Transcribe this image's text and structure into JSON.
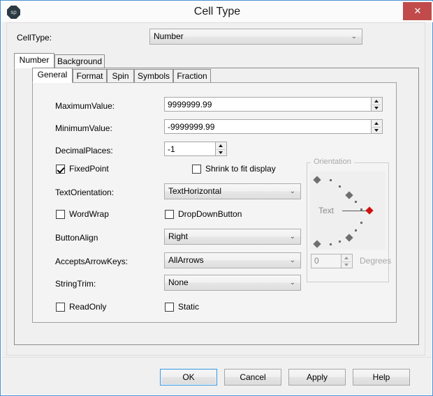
{
  "window": {
    "title": "Cell Type",
    "app_icon_text": "sp",
    "close_label": "✕",
    "accent_border": "#4a8fd0",
    "close_bg": "#c14b4b"
  },
  "celltype": {
    "label": "CellType:",
    "value": "Number",
    "arrow": "⌄",
    "options": [
      "Number"
    ]
  },
  "outer_tabs": [
    {
      "label": "Number",
      "active": true
    },
    {
      "label": "Background",
      "active": false
    }
  ],
  "inner_tabs": [
    {
      "label": "General",
      "active": true
    },
    {
      "label": "Format",
      "active": false
    },
    {
      "label": "Spin",
      "active": false
    },
    {
      "label": "Symbols",
      "active": false
    },
    {
      "label": "Fraction",
      "active": false
    }
  ],
  "fields": {
    "maximum_value": {
      "label": "MaximumValue:",
      "value": "9999999.99"
    },
    "minimum_value": {
      "label": "MinimumValue:",
      "value": "-9999999.99"
    },
    "decimal_places": {
      "label": "DecimalPlaces:",
      "value": "-1"
    },
    "text_orientation": {
      "label": "TextOrientation:",
      "value": "TextHorizontal",
      "arrow": "⌄"
    },
    "button_align": {
      "label": "ButtonAlign",
      "value": "Right",
      "arrow": "⌄"
    },
    "accepts_arrow_keys": {
      "label": "AcceptsArrowKeys:",
      "value": "AllArrows",
      "arrow": "⌄"
    },
    "string_trim": {
      "label": "StringTrim:",
      "value": "None",
      "arrow": "⌄"
    }
  },
  "checkboxes": {
    "fixed_point": {
      "label": "FixedPoint",
      "checked": true
    },
    "shrink_to_fit": {
      "label": "Shrink to fit display",
      "checked": false
    },
    "word_wrap": {
      "label": "WordWrap",
      "checked": false
    },
    "drop_down_button": {
      "label": "DropDownButton",
      "checked": false
    },
    "read_only": {
      "label": "ReadOnly",
      "checked": false
    },
    "static": {
      "label": "Static",
      "checked": false
    }
  },
  "orientation": {
    "legend": "Orientation",
    "sample_text": "Text",
    "degrees_value": "0",
    "degrees_label": "Degrees",
    "handle_color": "#d01111",
    "enabled": false
  },
  "footer": {
    "ok": "OK",
    "cancel": "Cancel",
    "apply": "Apply",
    "help": "Help"
  }
}
